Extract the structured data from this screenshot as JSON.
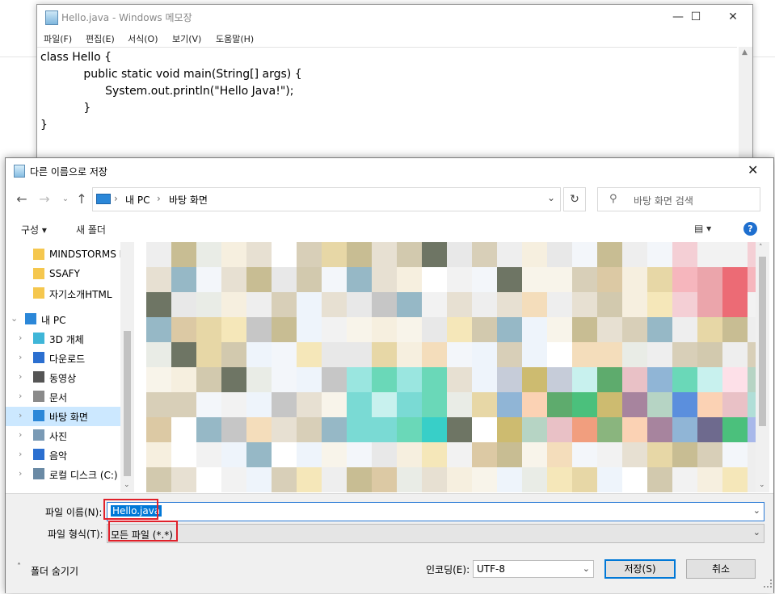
{
  "notepad": {
    "title": "Hello.java - Windows 메모장",
    "menu": [
      "파일(F)",
      "편집(E)",
      "서식(O)",
      "보기(V)",
      "도움말(H)"
    ],
    "code": "class Hello {\n\t\tpublic static void main(String[] args) {\n\t\t\tSystem.out.println(\"Hello Java!\");\n\t\t}\n}"
  },
  "dialog": {
    "title": "다른 이름으로 저장",
    "breadcrumb": [
      "내 PC",
      "바탕 화면"
    ],
    "search_placeholder": "바탕 화면 검색",
    "toolbar": {
      "organize": "구성 ▾",
      "new_folder": "새 폴더"
    },
    "sidebar": [
      {
        "label": "MINDSTORMS E",
        "icon": "folder-icon",
        "indent": 1,
        "selected": false
      },
      {
        "label": "SSAFY",
        "icon": "folder-icon",
        "indent": 1,
        "selected": false
      },
      {
        "label": "자기소개HTML",
        "icon": "folder-icon",
        "indent": 1,
        "selected": false
      },
      {
        "label": "내 PC",
        "icon": "pc-icon",
        "indent": 0,
        "selected": false
      },
      {
        "label": "3D 개체",
        "icon": "cube-icon",
        "indent": 1,
        "selected": false
      },
      {
        "label": "다운로드",
        "icon": "download-icon",
        "indent": 1,
        "selected": false
      },
      {
        "label": "동영상",
        "icon": "video-icon",
        "indent": 1,
        "selected": false
      },
      {
        "label": "문서",
        "icon": "document-icon",
        "indent": 1,
        "selected": false
      },
      {
        "label": "바탕 화면",
        "icon": "desktop-icon",
        "indent": 1,
        "selected": true
      },
      {
        "label": "사진",
        "icon": "picture-icon",
        "indent": 1,
        "selected": false
      },
      {
        "label": "음악",
        "icon": "music-icon",
        "indent": 1,
        "selected": false
      },
      {
        "label": "로컬 디스크 (C:)",
        "icon": "drive-icon",
        "indent": 1,
        "selected": false
      }
    ],
    "filename_label": "파일 이름(N):",
    "filename_value": "Hello.java",
    "filetype_label": "파일 형식(T):",
    "filetype_value": "모든 파일 (*.*)",
    "hide_folders": "폴더 숨기기",
    "encoding_label": "인코딩(E):",
    "encoding_value": "UTF-8",
    "save_button": "저장(S)",
    "cancel_button": "취소"
  }
}
